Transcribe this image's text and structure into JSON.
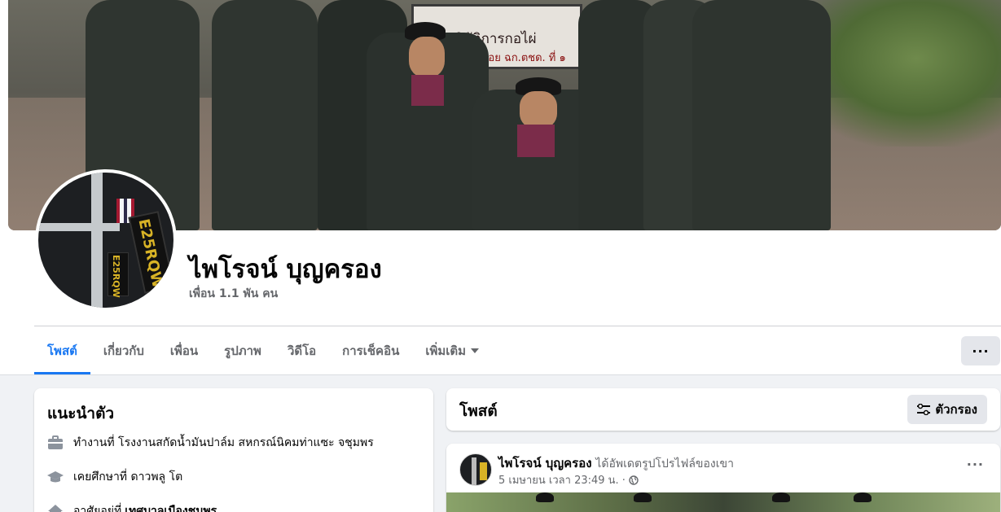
{
  "cover": {
    "sign_line1": "ฐานปฏิบัติการกอไผ่",
    "sign_line2": "ฉก.ตชด.ที่ ๓  ร้อย ฉก.ตชด. ที่ ๑"
  },
  "avatar": {
    "patch_text": "E25RQW",
    "patch2_text": "E25RQW"
  },
  "profile": {
    "name": "ไพโรจน์ บุญครอง",
    "friends": "เพื่อน 1.1 พัน คน"
  },
  "tabs": [
    {
      "label": "โพสต์",
      "active": true
    },
    {
      "label": "เกี่ยวกับ",
      "active": false
    },
    {
      "label": "เพื่อน",
      "active": false
    },
    {
      "label": "รูปภาพ",
      "active": false
    },
    {
      "label": "วิดีโอ",
      "active": false
    },
    {
      "label": "การเช็คอิน",
      "active": false
    },
    {
      "label": "เพิ่มเติม",
      "active": false
    }
  ],
  "more_button": "···",
  "intro": {
    "title": "แนะนำตัว",
    "items": [
      {
        "icon": "briefcase-icon",
        "prefix": "ทำงานที่",
        "value": "โรงงานสกัดน้ำมันปาล์ม สหกรณ์นิคมท่าแซะ จชุมพร"
      },
      {
        "icon": "graduation-cap-icon",
        "prefix": "เคยศึกษาที่",
        "value": "ดาวพลู โต"
      },
      {
        "icon": "home-icon",
        "prefix": "อาศัยอยู่ที่",
        "value": "เทศบาลเมืองชุมพร"
      }
    ]
  },
  "posts": {
    "title": "โพสต์",
    "filter_label": "ตัวกรอง"
  },
  "post": {
    "author": "ไพโรจน์ บุญครอง",
    "action": "ได้อัพเดตรูปโปรไฟล์ของเขา",
    "time": "5 เมษายน เวลา 23:49 น. ·",
    "menu": "···"
  },
  "colors": {
    "accent": "#1877f2",
    "secondary_text": "#65676b",
    "background": "#f0f2f5"
  }
}
